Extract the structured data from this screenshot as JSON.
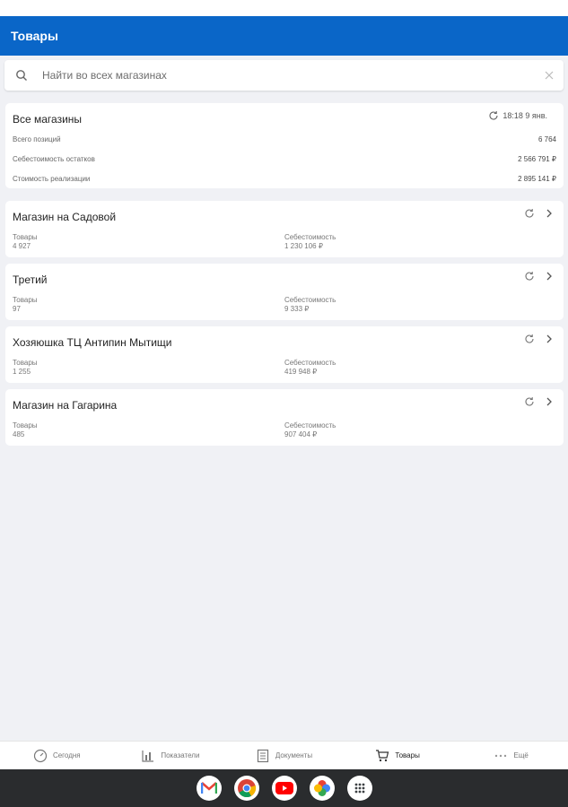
{
  "header": {
    "title": "Товары"
  },
  "search": {
    "placeholder": "Найти во всех магазинах"
  },
  "summary": {
    "title": "Все магазины",
    "sync_time": "18:18 9 янв.",
    "rows": [
      {
        "label": "Всего позиций",
        "value": "6 764"
      },
      {
        "label": "Себестоимость остатков",
        "value": "2 566 791 ₽"
      },
      {
        "label": "Стоимость реализации",
        "value": "2 895 141 ₽"
      }
    ]
  },
  "stores": [
    {
      "name": "Магазин на Садовой",
      "goods_label": "Товары",
      "goods": "4 927",
      "cost_label": "Себестоимость",
      "cost": "1 230 106 ₽"
    },
    {
      "name": "Третий",
      "goods_label": "Товары",
      "goods": "97",
      "cost_label": "Себестоимость",
      "cost": "9 333 ₽"
    },
    {
      "name": "Хозяюшка ТЦ Антипин Мытищи",
      "goods_label": "Товары",
      "goods": "1 255",
      "cost_label": "Себестоимость",
      "cost": "419 948 ₽"
    },
    {
      "name": "Магазин на Гагарина",
      "goods_label": "Товары",
      "goods": "485",
      "cost_label": "Себестоимость",
      "cost": "907 404 ₽"
    }
  ],
  "nav": [
    {
      "label": "Сегодня",
      "icon": "gauge-icon"
    },
    {
      "label": "Показатели",
      "icon": "bar-chart-icon"
    },
    {
      "label": "Документы",
      "icon": "document-icon"
    },
    {
      "label": "Товары",
      "icon": "cart-icon",
      "active": true
    },
    {
      "label": "Ещё",
      "icon": "more-icon"
    }
  ],
  "dock_apps": [
    "gmail-icon",
    "chrome-icon",
    "youtube-icon",
    "photos-icon",
    "app-drawer-icon"
  ],
  "colors": {
    "primary": "#0a66c8",
    "background": "#f0f1f5",
    "dock": "#2a2c2e"
  }
}
